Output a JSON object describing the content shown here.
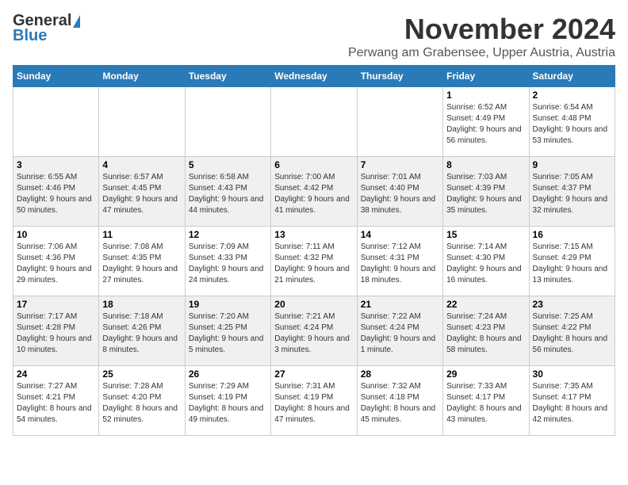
{
  "logo": {
    "general": "General",
    "blue": "Blue"
  },
  "title": "November 2024",
  "subtitle": "Perwang am Grabensee, Upper Austria, Austria",
  "headers": [
    "Sunday",
    "Monday",
    "Tuesday",
    "Wednesday",
    "Thursday",
    "Friday",
    "Saturday"
  ],
  "weeks": [
    [
      {
        "day": "",
        "info": ""
      },
      {
        "day": "",
        "info": ""
      },
      {
        "day": "",
        "info": ""
      },
      {
        "day": "",
        "info": ""
      },
      {
        "day": "",
        "info": ""
      },
      {
        "day": "1",
        "info": "Sunrise: 6:52 AM\nSunset: 4:49 PM\nDaylight: 9 hours and 56 minutes."
      },
      {
        "day": "2",
        "info": "Sunrise: 6:54 AM\nSunset: 4:48 PM\nDaylight: 9 hours and 53 minutes."
      }
    ],
    [
      {
        "day": "3",
        "info": "Sunrise: 6:55 AM\nSunset: 4:46 PM\nDaylight: 9 hours and 50 minutes."
      },
      {
        "day": "4",
        "info": "Sunrise: 6:57 AM\nSunset: 4:45 PM\nDaylight: 9 hours and 47 minutes."
      },
      {
        "day": "5",
        "info": "Sunrise: 6:58 AM\nSunset: 4:43 PM\nDaylight: 9 hours and 44 minutes."
      },
      {
        "day": "6",
        "info": "Sunrise: 7:00 AM\nSunset: 4:42 PM\nDaylight: 9 hours and 41 minutes."
      },
      {
        "day": "7",
        "info": "Sunrise: 7:01 AM\nSunset: 4:40 PM\nDaylight: 9 hours and 38 minutes."
      },
      {
        "day": "8",
        "info": "Sunrise: 7:03 AM\nSunset: 4:39 PM\nDaylight: 9 hours and 35 minutes."
      },
      {
        "day": "9",
        "info": "Sunrise: 7:05 AM\nSunset: 4:37 PM\nDaylight: 9 hours and 32 minutes."
      }
    ],
    [
      {
        "day": "10",
        "info": "Sunrise: 7:06 AM\nSunset: 4:36 PM\nDaylight: 9 hours and 29 minutes."
      },
      {
        "day": "11",
        "info": "Sunrise: 7:08 AM\nSunset: 4:35 PM\nDaylight: 9 hours and 27 minutes."
      },
      {
        "day": "12",
        "info": "Sunrise: 7:09 AM\nSunset: 4:33 PM\nDaylight: 9 hours and 24 minutes."
      },
      {
        "day": "13",
        "info": "Sunrise: 7:11 AM\nSunset: 4:32 PM\nDaylight: 9 hours and 21 minutes."
      },
      {
        "day": "14",
        "info": "Sunrise: 7:12 AM\nSunset: 4:31 PM\nDaylight: 9 hours and 18 minutes."
      },
      {
        "day": "15",
        "info": "Sunrise: 7:14 AM\nSunset: 4:30 PM\nDaylight: 9 hours and 16 minutes."
      },
      {
        "day": "16",
        "info": "Sunrise: 7:15 AM\nSunset: 4:29 PM\nDaylight: 9 hours and 13 minutes."
      }
    ],
    [
      {
        "day": "17",
        "info": "Sunrise: 7:17 AM\nSunset: 4:28 PM\nDaylight: 9 hours and 10 minutes."
      },
      {
        "day": "18",
        "info": "Sunrise: 7:18 AM\nSunset: 4:26 PM\nDaylight: 9 hours and 8 minutes."
      },
      {
        "day": "19",
        "info": "Sunrise: 7:20 AM\nSunset: 4:25 PM\nDaylight: 9 hours and 5 minutes."
      },
      {
        "day": "20",
        "info": "Sunrise: 7:21 AM\nSunset: 4:24 PM\nDaylight: 9 hours and 3 minutes."
      },
      {
        "day": "21",
        "info": "Sunrise: 7:22 AM\nSunset: 4:24 PM\nDaylight: 9 hours and 1 minute."
      },
      {
        "day": "22",
        "info": "Sunrise: 7:24 AM\nSunset: 4:23 PM\nDaylight: 8 hours and 58 minutes."
      },
      {
        "day": "23",
        "info": "Sunrise: 7:25 AM\nSunset: 4:22 PM\nDaylight: 8 hours and 56 minutes."
      }
    ],
    [
      {
        "day": "24",
        "info": "Sunrise: 7:27 AM\nSunset: 4:21 PM\nDaylight: 8 hours and 54 minutes."
      },
      {
        "day": "25",
        "info": "Sunrise: 7:28 AM\nSunset: 4:20 PM\nDaylight: 8 hours and 52 minutes."
      },
      {
        "day": "26",
        "info": "Sunrise: 7:29 AM\nSunset: 4:19 PM\nDaylight: 8 hours and 49 minutes."
      },
      {
        "day": "27",
        "info": "Sunrise: 7:31 AM\nSunset: 4:19 PM\nDaylight: 8 hours and 47 minutes."
      },
      {
        "day": "28",
        "info": "Sunrise: 7:32 AM\nSunset: 4:18 PM\nDaylight: 8 hours and 45 minutes."
      },
      {
        "day": "29",
        "info": "Sunrise: 7:33 AM\nSunset: 4:17 PM\nDaylight: 8 hours and 43 minutes."
      },
      {
        "day": "30",
        "info": "Sunrise: 7:35 AM\nSunset: 4:17 PM\nDaylight: 8 hours and 42 minutes."
      }
    ]
  ]
}
